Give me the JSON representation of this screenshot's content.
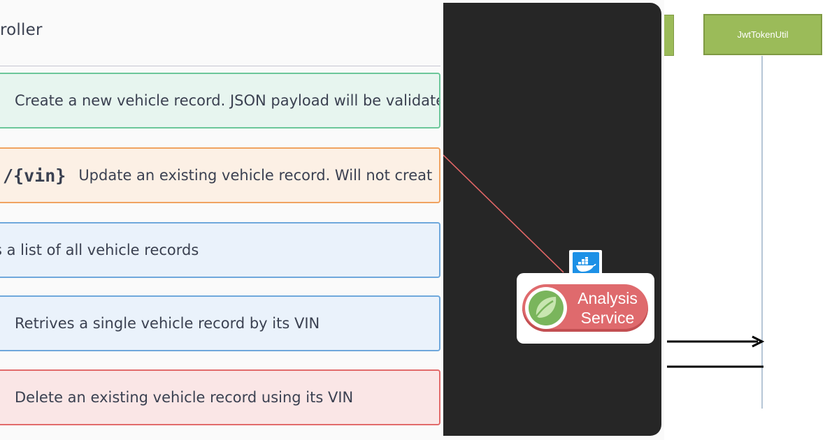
{
  "swagger": {
    "controller_title": "roller",
    "operations": [
      {
        "method": "post",
        "path": "",
        "description": "Create a new vehicle record. JSON payload will be validate"
      },
      {
        "method": "put",
        "path": "/{vin}",
        "description": "Update an existing vehicle record. Will not creat"
      },
      {
        "method": "get",
        "path": "",
        "description": "s a list of all vehicle records"
      },
      {
        "method": "get",
        "path": "",
        "description": "Retrives a single vehicle record by its VIN"
      },
      {
        "method": "delete",
        "path": "",
        "description": "Delete an existing vehicle record using its VIN"
      }
    ],
    "colors": {
      "post_bg": "#e7f5ef",
      "post_border": "#6cc79a",
      "put_bg": "#fcf0e5",
      "put_border": "#f0a361",
      "get_bg": "#eaf2fb",
      "get_border": "#6fa8dc",
      "delete_bg": "#fae6e6",
      "delete_border": "#e26b6b"
    }
  },
  "architecture": {
    "service_line1": "Analysis",
    "service_line2": "Service",
    "icons": [
      "docker-icon",
      "spring-leaf-icon"
    ],
    "colors": {
      "background": "#262626",
      "service": "#df6a6d",
      "connector": "#e06666",
      "docker": "#1d91e6"
    }
  },
  "sequence": {
    "participant": "JwtTokenUtil",
    "colors": {
      "participant_fill": "#9bbb59",
      "lifeline": "#9db3c8"
    }
  }
}
